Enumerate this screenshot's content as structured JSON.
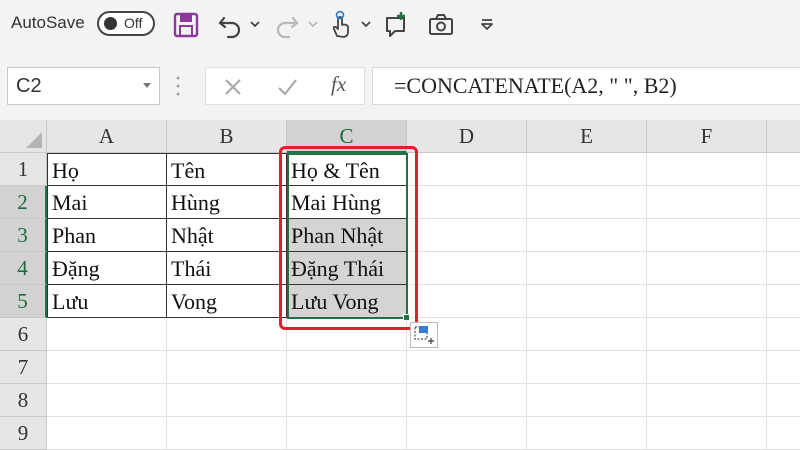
{
  "toolbar": {
    "autosave_label": "AutoSave",
    "autosave_state": "Off",
    "icons": [
      "save-icon",
      "undo-icon",
      "redo-icon",
      "touch-mode-icon",
      "new-comment-icon",
      "camera-icon",
      "customize-qat-icon"
    ]
  },
  "formula_bar": {
    "name_box": "C2",
    "fx_label": "fx",
    "formula": "=CONCATENATE(A2, \" \", B2)"
  },
  "sheet": {
    "columns": [
      "A",
      "B",
      "C",
      "D",
      "E",
      "F"
    ],
    "rows": [
      "1",
      "2",
      "3",
      "4",
      "5",
      "6",
      "7",
      "8",
      "9"
    ],
    "cells": {
      "A1": "Họ",
      "B1": "Tên",
      "C1": "Họ & Tên",
      "A2": "Mai",
      "B2": "Hùng",
      "C2": "Mai Hùng",
      "A3": "Phan",
      "B3": "Nhật",
      "C3": "Phan Nhật",
      "A4": "Đặng",
      "B4": "Thái",
      "C4": "Đặng Thái",
      "A5": "Lưu",
      "B5": "Vong",
      "C5": "Lưu Vong"
    },
    "selected_column": "C",
    "selected_range": "C2:C5"
  },
  "colors": {
    "excel_green": "#217346",
    "highlight_red": "#e0202e",
    "save_purple": "#8a3a9b"
  }
}
